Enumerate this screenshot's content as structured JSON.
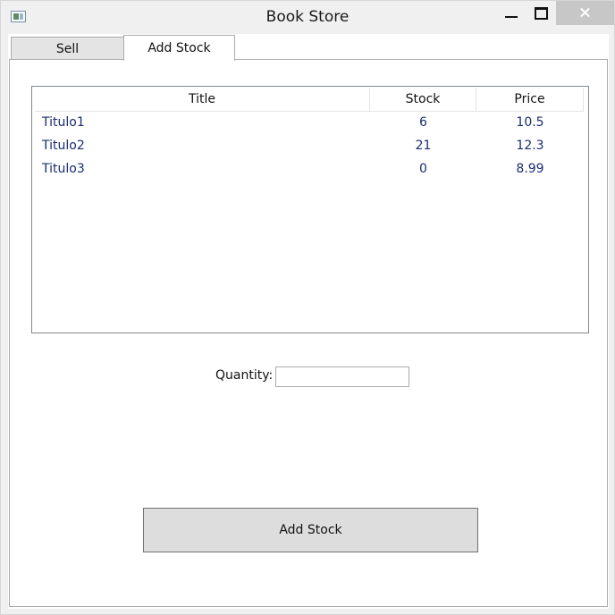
{
  "window": {
    "title": "Book Store"
  },
  "tabs": [
    {
      "label": "Sell",
      "selected": false
    },
    {
      "label": "Add Stock",
      "selected": true
    }
  ],
  "table": {
    "columns": [
      "Title",
      "Stock",
      "Price"
    ],
    "rows": [
      {
        "title": "Titulo1",
        "stock": "6",
        "price": "10.5"
      },
      {
        "title": "Titulo2",
        "stock": "21",
        "price": "12.3"
      },
      {
        "title": "Titulo3",
        "stock": "0",
        "price": "8.99"
      }
    ]
  },
  "form": {
    "quantity_label": "Quantity:",
    "quantity_value": ""
  },
  "actions": {
    "add_stock_label": "Add Stock"
  },
  "icons": {
    "app": "app-window-icon",
    "minimize": "minimize-icon",
    "maximize": "maximize-icon",
    "close": "close-icon"
  },
  "colors": {
    "row_text": "#1b2c6f",
    "close_button_bg": "#c7c7c7",
    "button_bg": "#dddddd"
  }
}
